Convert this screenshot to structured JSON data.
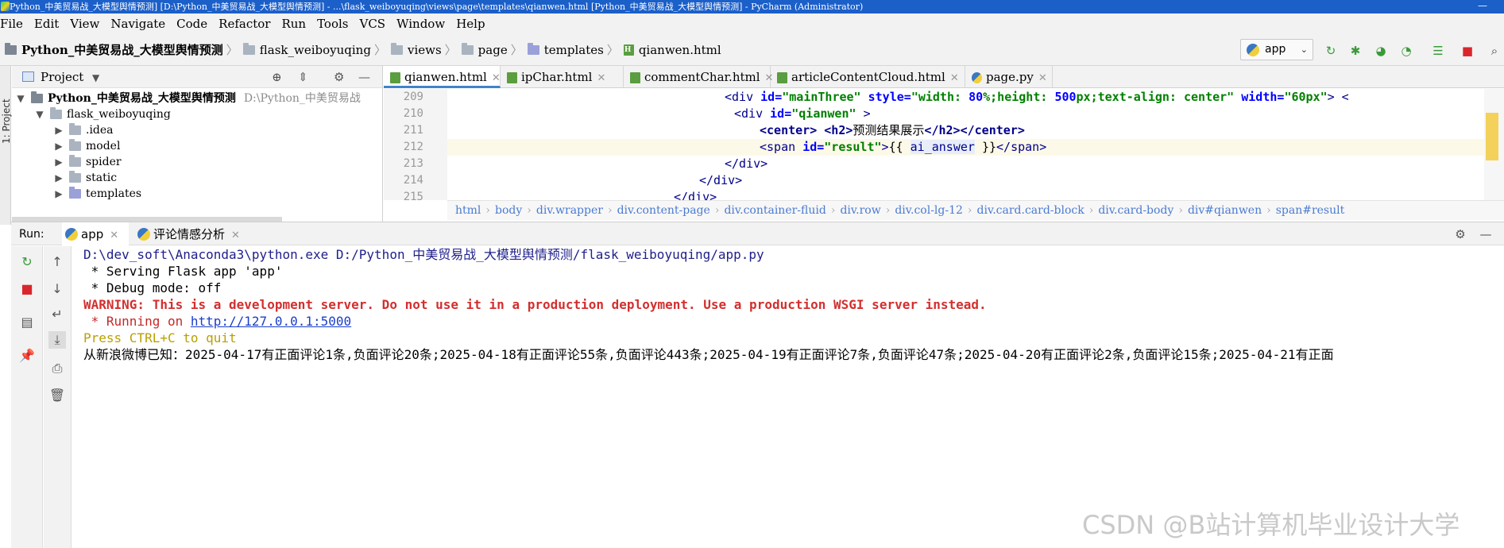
{
  "window": {
    "title": "Python_中美贸易战_大模型舆情预测] [D:\\Python_中美贸易战_大模型舆情预测] - ...\\flask_weiboyuqing\\views\\page\\templates\\qianwen.html [Python_中美贸易战_大模型舆情预测] - PyCharm (Administrator)",
    "minimize": "—",
    "maximize": "□"
  },
  "menu": [
    "File",
    "Edit",
    "View",
    "Navigate",
    "Code",
    "Refactor",
    "Run",
    "Tools",
    "VCS",
    "Window",
    "Help"
  ],
  "nav": {
    "crumbs": [
      "Python_中美贸易战_大模型舆情预测",
      "flask_weiboyuqing",
      "views",
      "page",
      "templates",
      "qianwen.html"
    ],
    "run_config": "app"
  },
  "project_panel": {
    "title": "Project",
    "strip_label": "1: Project",
    "tree": [
      {
        "label": "Python_中美贸易战_大模型舆情预测",
        "hint": "D:\\Python_中美贸易战",
        "arrow": "▼"
      },
      {
        "label": "flask_weiboyuqing",
        "arrow": "▼"
      },
      {
        "label": ".idea",
        "arrow": "▶"
      },
      {
        "label": "model",
        "arrow": "▶"
      },
      {
        "label": "spider",
        "arrow": "▶"
      },
      {
        "label": "static",
        "arrow": "▶"
      },
      {
        "label": "templates",
        "arrow": "▶"
      }
    ]
  },
  "editor": {
    "tabs": [
      "qianwen.html",
      "ipChar.html",
      "commentChar.html",
      "articleContentCloud.html",
      "page.py"
    ],
    "line_numbers": [
      "209",
      "210",
      "211",
      "212",
      "213",
      "214",
      "215"
    ],
    "code": {
      "l209": {
        "open": "<div ",
        "a1": "id=",
        "v1": "\"mainThree\" ",
        "a2": "style=",
        "v2": "\"width: ",
        "num1": "80",
        "v3": "%;height: ",
        "num2": "500",
        "v4": "px;text-align: center\" ",
        "a3": "width=",
        "v5": "\"60px\"",
        "close": "> <"
      },
      "l210": {
        "open": "<div ",
        "a1": "id=",
        "v1": "\"qianwen\" ",
        "close": ">"
      },
      "l211": {
        "t1": "<center> ",
        "t2": "<h2>",
        "text": "预测结果展示",
        "t3": "</h2></center>"
      },
      "l212": {
        "open": "<span ",
        "a1": "id=",
        "v1": "\"result\"",
        "close": ">",
        "tmpl_open": "{{ ",
        "tmpl_var": "ai_answer",
        "tmpl_close": " }}",
        "end": "</span>"
      },
      "l213": "</div>",
      "l214": "</div>",
      "l215": "</div>"
    },
    "breadcrumbs": [
      "html",
      "body",
      "div.wrapper",
      "div.content-page",
      "div.container-fluid",
      "div.row",
      "div.col-lg-12",
      "div.card.card-block",
      "div.card-body",
      "div#qianwen",
      "span#result"
    ]
  },
  "run": {
    "label": "Run:",
    "tabs": [
      "app",
      "评论情感分析"
    ],
    "console": {
      "line1": "D:\\dev_soft\\Anaconda3\\python.exe D:/Python_中美贸易战_大模型舆情预测/flask_weiboyuqing/app.py",
      "line2": " * Serving Flask app 'app'",
      "line3": " * Debug mode: off",
      "line4": "WARNING: This is a development server. Do not use it in a production deployment. Use a production WSGI server instead.",
      "line5_prefix": " * Running on ",
      "line5_link": "http://127.0.0.1:5000",
      "line6": "Press CTRL+C to quit",
      "line7": "从新浪微博已知：2025-04-17有正面评论1条,负面评论20条;2025-04-18有正面评论55条,负面评论443条;2025-04-19有正面评论7条,负面评论47条;2025-04-20有正面评论2条,负面评论15条;2025-04-21有正面"
    }
  },
  "watermark": "CSDN @B站计算机毕业设计大学"
}
